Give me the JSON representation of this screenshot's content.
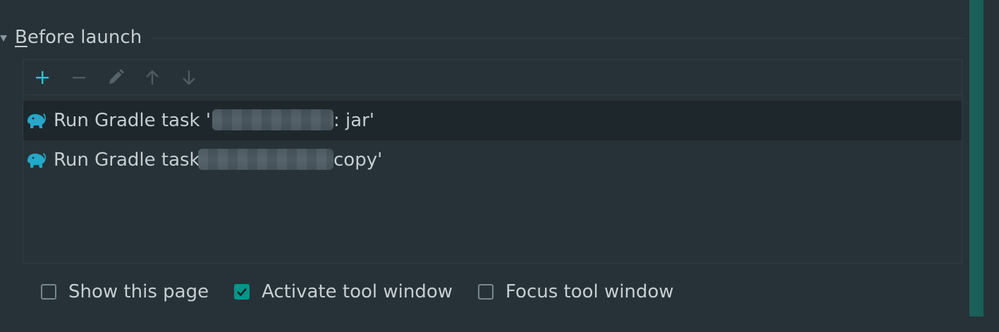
{
  "section": {
    "title_mnemonic": "B",
    "title_rest": "efore launch"
  },
  "toolbar": {
    "buttons": [
      {
        "icon": "plus-icon",
        "enabled": true,
        "color": "#26c6da"
      },
      {
        "icon": "minus-icon",
        "enabled": false
      },
      {
        "icon": "pencil-icon",
        "enabled": false
      },
      {
        "icon": "arrow-up-icon",
        "enabled": false
      },
      {
        "icon": "arrow-down-icon",
        "enabled": false
      }
    ]
  },
  "tasks": [
    {
      "icon": "gradle-elephant-icon",
      "prefix": "Run Gradle task '",
      "suffix": ": jar'",
      "selected": true
    },
    {
      "icon": "gradle-elephant-icon",
      "prefix": "Run Gradle task ",
      "suffix": "copy'",
      "selected": false
    }
  ],
  "options": [
    {
      "label": "Show this page",
      "checked": false
    },
    {
      "label": "Activate tool window",
      "checked": true
    },
    {
      "label": "Focus tool window",
      "checked": false
    }
  ],
  "colors": {
    "background": "#263238",
    "accent": "#009688",
    "add_icon": "#26c6da",
    "gradle_icon": "#26a7c9"
  }
}
